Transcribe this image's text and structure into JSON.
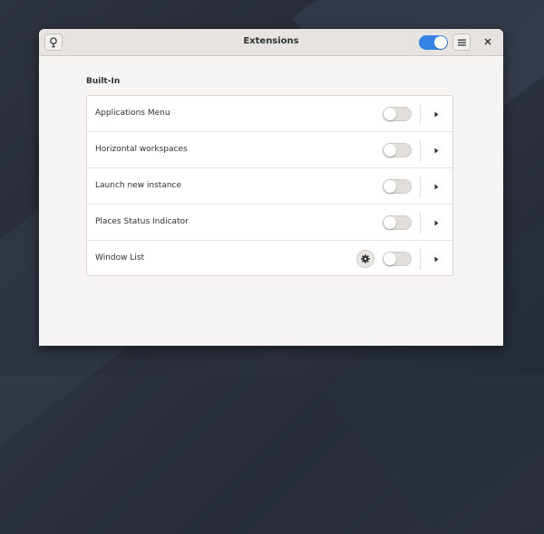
{
  "window": {
    "title": "Extensions",
    "extensions_enabled": true
  },
  "icons": {
    "left_button": "lightbulb-icon",
    "menu_button": "hamburger-menu-icon",
    "close": "close-icon",
    "row_settings": "gear-icon",
    "row_expand": "chevron-right-icon"
  },
  "colors": {
    "accent": "#3584e4",
    "window_bg": "#f6f5f4",
    "headerbar_bg": "#e6e3e0"
  },
  "section": {
    "heading": "Built-In",
    "items": [
      {
        "label": "Applications Menu",
        "enabled": false,
        "has_settings": false
      },
      {
        "label": "Horizontal workspaces",
        "enabled": false,
        "has_settings": false
      },
      {
        "label": "Launch new instance",
        "enabled": false,
        "has_settings": false
      },
      {
        "label": "Places Status Indicator",
        "enabled": false,
        "has_settings": false
      },
      {
        "label": "Window List",
        "enabled": false,
        "has_settings": true
      }
    ]
  }
}
